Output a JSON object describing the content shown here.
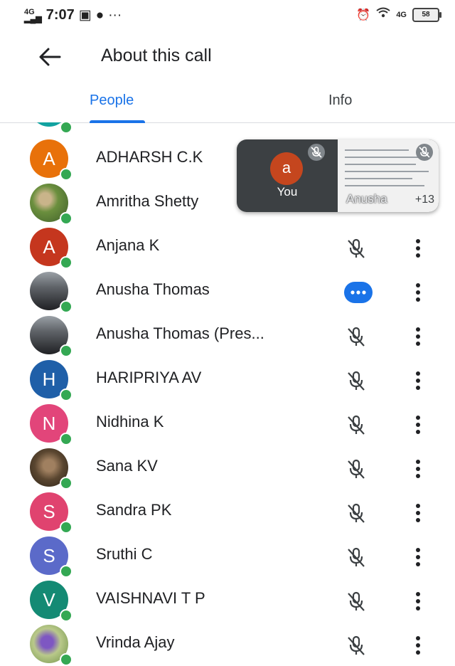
{
  "status_bar": {
    "network": "4G",
    "time": "7:07",
    "more": "···",
    "network_right": "4G",
    "battery": "58"
  },
  "header": {
    "title": "About this call"
  },
  "tabs": [
    {
      "label": "People",
      "active": true
    },
    {
      "label": "Info",
      "active": false
    }
  ],
  "participants": [
    {
      "name": "ADHARSH C.K",
      "initial": "A",
      "avatar_color": "#e8710a",
      "status": "muted"
    },
    {
      "name": "Amritha Shetty",
      "initial": "",
      "avatar_color": "#7c8a4e",
      "status": "muted"
    },
    {
      "name": "Anjana K",
      "initial": "A",
      "avatar_color": "#c5361e",
      "status": "muted"
    },
    {
      "name": "Anusha Thomas",
      "initial": "",
      "avatar_color": "#3a3a3a",
      "status": "speaking"
    },
    {
      "name": "Anusha Thomas (Pres...",
      "initial": "",
      "avatar_color": "#3a3a3a",
      "status": "muted"
    },
    {
      "name": "HARIPRIYA AV",
      "initial": "H",
      "avatar_color": "#1f5fa8",
      "status": "muted"
    },
    {
      "name": "Nidhina K",
      "initial": "N",
      "avatar_color": "#e2457a",
      "status": "muted"
    },
    {
      "name": "Sana KV",
      "initial": "",
      "avatar_color": "#5a4630",
      "status": "muted"
    },
    {
      "name": "Sandra PK",
      "initial": "S",
      "avatar_color": "#e0436f",
      "status": "muted"
    },
    {
      "name": "Sruthi C",
      "initial": "S",
      "avatar_color": "#5b6ac9",
      "status": "muted"
    },
    {
      "name": "VAISHNAVI T P",
      "initial": "V",
      "avatar_color": "#148a74",
      "status": "muted"
    },
    {
      "name": "Vrinda Ajay",
      "initial": "",
      "avatar_color": "#8e6fa8",
      "status": "muted"
    }
  ],
  "self_view": {
    "initial": "a",
    "label": "You",
    "presenter_label": "Anusha",
    "more_count": "+13"
  },
  "colors": {
    "accent": "#1a73e8",
    "presence": "#34a853",
    "icon": "#3c4043"
  }
}
